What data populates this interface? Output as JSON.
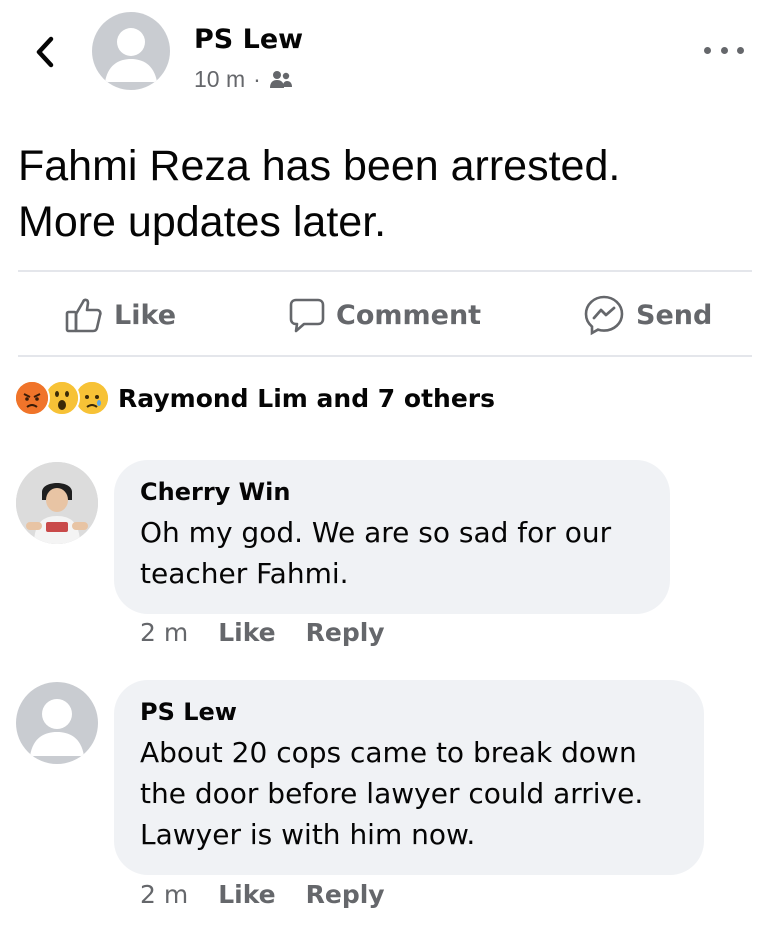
{
  "post": {
    "author": "PS Lew",
    "time": "10 m",
    "separator": "·",
    "text_line1": "Fahmi Reza has been arrested.",
    "text_line2": "More updates later."
  },
  "actions": {
    "like": "Like",
    "comment": "Comment",
    "send": "Send"
  },
  "reactions": {
    "summary": "Raymond Lim and 7 others",
    "types": [
      "angry",
      "wow",
      "sad"
    ]
  },
  "comments": [
    {
      "author": "Cherry Win",
      "line1": "Oh my god. We are so sad for our",
      "line2": "teacher Fahmi.",
      "time": "2 m",
      "like": "Like",
      "reply": "Reply"
    },
    {
      "author": "PS Lew",
      "line1": "About 20 cops came to break down",
      "line2": "the door before lawyer could arrive.",
      "line3": "Lawyer is with him now.",
      "time": "2 m",
      "like": "Like",
      "reply": "Reply"
    }
  ],
  "colors": {
    "secondary_text": "#65676b",
    "bubble": "#f0f2f5",
    "divider": "#e4e6eb",
    "avatar_placeholder": "#c9ccd1"
  }
}
